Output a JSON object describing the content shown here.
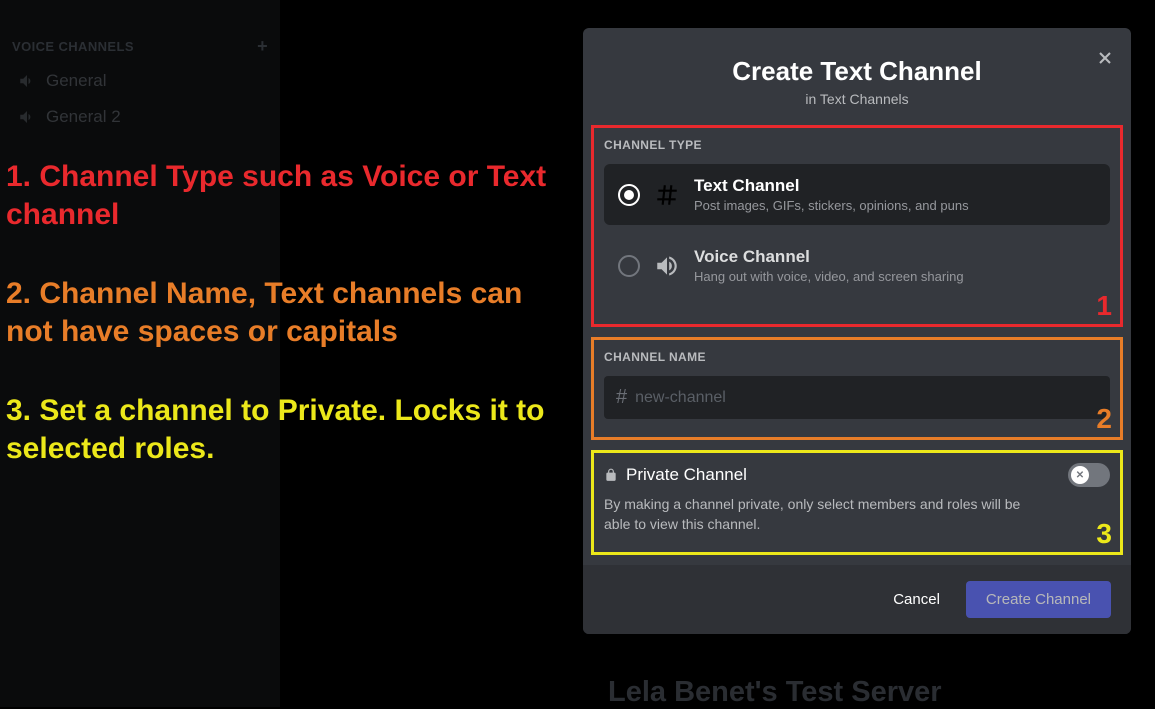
{
  "sidebar": {
    "voice_header": "VOICE CHANNELS",
    "items": [
      "General",
      "General 2"
    ]
  },
  "annotations": {
    "a1": "1. Channel Type such as Voice or Text channel",
    "a2": "2. Channel Name, Text channels can not have spaces or capitals",
    "a3": "3. Set a channel to Private. Locks it to selected roles."
  },
  "modal": {
    "title": "Create Text Channel",
    "subtitle": "in Text Channels",
    "channel_type_label": "CHANNEL TYPE",
    "text_option": {
      "title": "Text Channel",
      "desc": "Post images, GIFs, stickers, opinions, and puns"
    },
    "voice_option": {
      "title": "Voice Channel",
      "desc": "Hang out with voice, video, and screen sharing"
    },
    "channel_name_label": "CHANNEL NAME",
    "name_placeholder": "new-channel",
    "private_title": "Private Channel",
    "private_desc": "By making a channel private, only select members and roles will be able to view this channel.",
    "cancel": "Cancel",
    "create": "Create Channel"
  },
  "box_nums": {
    "one": "1",
    "two": "2",
    "three": "3"
  },
  "ghost": "Lela Benet's Test Server"
}
